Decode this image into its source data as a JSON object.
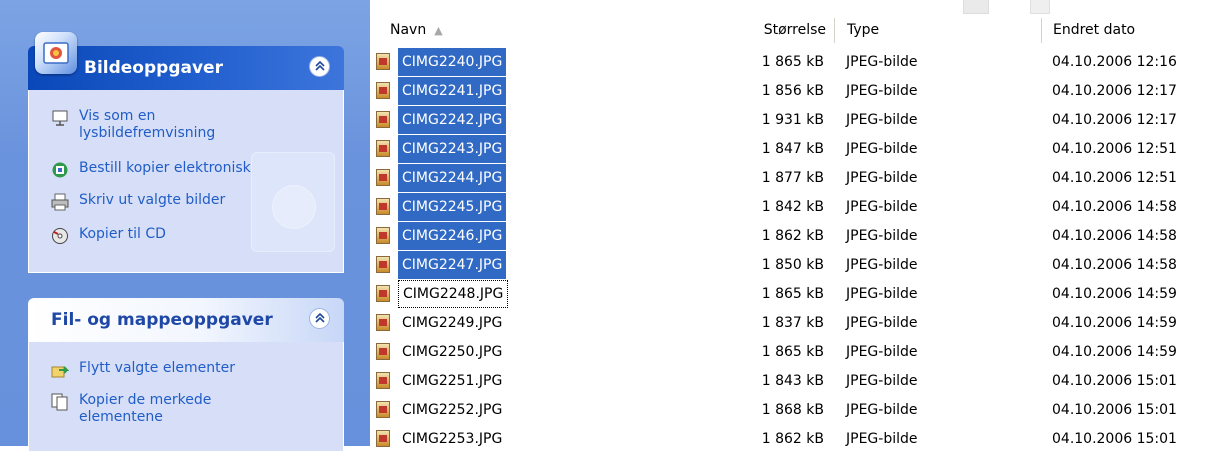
{
  "task_pane": {
    "picture_tasks": {
      "title": "Bildeoppgaver",
      "collapse_glyph": "«",
      "tasks": [
        {
          "icon": "slideshow-icon",
          "label": "Vis som en lysbildefremvisning"
        },
        {
          "icon": "order-prints-icon",
          "label": "Bestill kopier elektronisk"
        },
        {
          "icon": "print-icon",
          "label": "Skriv ut valgte bilder"
        },
        {
          "icon": "burn-cd-icon",
          "label": "Kopier til CD"
        }
      ]
    },
    "file_tasks": {
      "title": "Fil- og mappeoppgaver",
      "collapse_glyph": "«",
      "tasks": [
        {
          "icon": "move-icon",
          "label": "Flytt valgte elementer"
        },
        {
          "icon": "copy-icon",
          "label": "Kopier de merkede elementene"
        }
      ]
    }
  },
  "file_list": {
    "columns": {
      "name": "Navn",
      "size": "Størrelse",
      "type": "Type",
      "date": "Endret dato"
    },
    "rows": [
      {
        "name": "CIMG2240.JPG",
        "size": "1 865 kB",
        "type": "JPEG-bilde",
        "date": "04.10.2006 12:16",
        "selected": true
      },
      {
        "name": "CIMG2241.JPG",
        "size": "1 856 kB",
        "type": "JPEG-bilde",
        "date": "04.10.2006 12:17",
        "selected": true
      },
      {
        "name": "CIMG2242.JPG",
        "size": "1 931 kB",
        "type": "JPEG-bilde",
        "date": "04.10.2006 12:17",
        "selected": true
      },
      {
        "name": "CIMG2243.JPG",
        "size": "1 847 kB",
        "type": "JPEG-bilde",
        "date": "04.10.2006 12:51",
        "selected": true
      },
      {
        "name": "CIMG2244.JPG",
        "size": "1 877 kB",
        "type": "JPEG-bilde",
        "date": "04.10.2006 12:51",
        "selected": true
      },
      {
        "name": "CIMG2245.JPG",
        "size": "1 842 kB",
        "type": "JPEG-bilde",
        "date": "04.10.2006 14:58",
        "selected": true
      },
      {
        "name": "CIMG2246.JPG",
        "size": "1 862 kB",
        "type": "JPEG-bilde",
        "date": "04.10.2006 14:58",
        "selected": true
      },
      {
        "name": "CIMG2247.JPG",
        "size": "1 850 kB",
        "type": "JPEG-bilde",
        "date": "04.10.2006 14:58",
        "selected": true
      },
      {
        "name": "CIMG2248.JPG",
        "size": "1 865 kB",
        "type": "JPEG-bilde",
        "date": "04.10.2006 14:59",
        "selected": false,
        "focused": true
      },
      {
        "name": "CIMG2249.JPG",
        "size": "1 837 kB",
        "type": "JPEG-bilde",
        "date": "04.10.2006 14:59",
        "selected": false
      },
      {
        "name": "CIMG2250.JPG",
        "size": "1 865 kB",
        "type": "JPEG-bilde",
        "date": "04.10.2006 14:59",
        "selected": false
      },
      {
        "name": "CIMG2251.JPG",
        "size": "1 843 kB",
        "type": "JPEG-bilde",
        "date": "04.10.2006 15:01",
        "selected": false
      },
      {
        "name": "CIMG2252.JPG",
        "size": "1 868 kB",
        "type": "JPEG-bilde",
        "date": "04.10.2006 15:01",
        "selected": false
      },
      {
        "name": "CIMG2253.JPG",
        "size": "1 862 kB",
        "type": "JPEG-bilde",
        "date": "04.10.2006 15:01",
        "selected": false
      }
    ]
  },
  "colors": {
    "selection": "#316ac5",
    "task_link": "#215dc6",
    "pane_background": "#6a93dd"
  }
}
